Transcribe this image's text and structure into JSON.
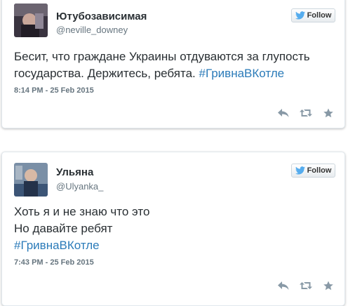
{
  "colors": {
    "hashtag": "#2b7bb9",
    "twitter_bird": "#55acee",
    "action_icons": "#8899a6"
  },
  "tweets": [
    {
      "display_name": "Ютубозависимая",
      "username": "@neville_downey",
      "follow_label": "Follow",
      "text_lines": [
        {
          "plain": "Бесит, что граждане Украины отдуваются за глупость",
          "hashtag": ""
        },
        {
          "plain": "государства. Держитесь, ребята. ",
          "hashtag": "#ГривнаВКотле"
        }
      ],
      "timestamp": "8:14 PM - 25 Feb 2015",
      "actions": [
        "reply-icon",
        "retweet-icon",
        "favorite-icon"
      ]
    },
    {
      "display_name": "Ульяна",
      "username": "@Ulyanka_",
      "follow_label": "Follow",
      "text_lines": [
        {
          "plain": "Хоть я и не знаю что это",
          "hashtag": ""
        },
        {
          "plain": "Но давайте ребят",
          "hashtag": ""
        },
        {
          "plain": "",
          "hashtag": "#ГривнаВКотле"
        }
      ],
      "timestamp": "7:43 PM - 25 Feb 2015",
      "actions": [
        "reply-icon",
        "retweet-icon",
        "favorite-icon"
      ]
    }
  ]
}
